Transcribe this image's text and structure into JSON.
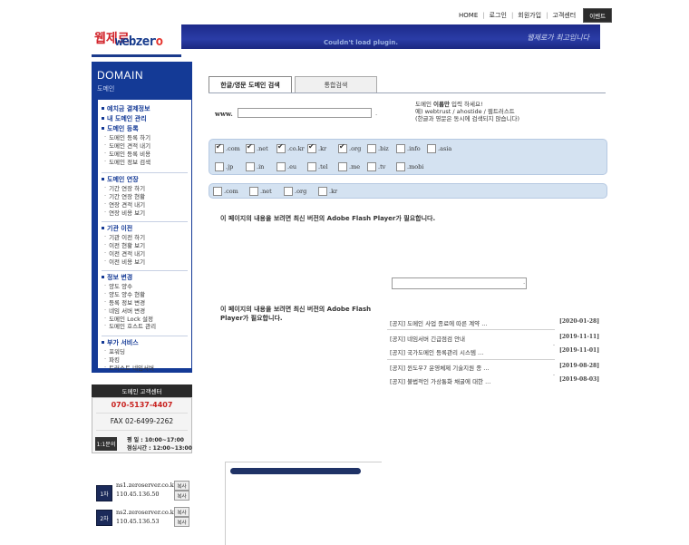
{
  "topnav": {
    "items": [
      "HOME",
      "로그인",
      "회원가입",
      "고객센터"
    ],
    "event_label": "이벤트"
  },
  "header": {
    "logo_kr": "웹제로",
    "logo_en_main": "webzer",
    "logo_en_last": "o",
    "plugin_message": "Couldn't load plugin.",
    "slogan": "웹제로가 최고입니다"
  },
  "sidebar": {
    "title": "DOMAIN",
    "subtitle": "도메인",
    "sections": [
      {
        "title": "예치금 결제정보",
        "items": []
      },
      {
        "title": "내 도메인 관리",
        "items": []
      },
      {
        "title": "도메인 등록",
        "items": [
          "도메인 등록 하기",
          "도메인 견적 내기",
          "도메인 등록 비용",
          "도메인 정보 검색"
        ]
      },
      {
        "title": "도메인 연장",
        "items": [
          "기간 연장 하기",
          "기간 연장 현황",
          "연장 견적 내기",
          "연장 비용 보기"
        ]
      },
      {
        "title": "기관 이전",
        "items": [
          "기관 이전 하기",
          "이전 현황 보기",
          "이전 견적 내기",
          "이전 비용 보기"
        ]
      },
      {
        "title": "정보 변경",
        "items": [
          "양도 양수",
          "양도 양수 현황",
          "등록 정보 변경",
          "네임 서버 변경",
          "도메인 Lock 설정",
          "도메인 호스트 관리"
        ]
      },
      {
        "title": "부가 서비스",
        "items": [
          "포워딩",
          "파킹",
          "트러스트 네임서버"
        ]
      }
    ]
  },
  "customer_center": {
    "title": "도메인 고객센터",
    "tel": "070-5137-4407",
    "fax": "FAX 02-6499-2262",
    "inquiry_label": "1:1문의",
    "hours_line1": "평    일 : 10:00~17:00",
    "hours_line2": "점심시간 : 12:00~13:00"
  },
  "nameservers": [
    {
      "no": "1차",
      "host": "ns1.zeroserver.co.kr",
      "ip": "110.45.136.50",
      "copy": "복사"
    },
    {
      "no": "2차",
      "host": "ns2.zeroserver.co.kr",
      "ip": "110.45.136.53",
      "copy": "복사"
    }
  ],
  "search": {
    "tabs": [
      "한글/영문 도메인 검색",
      "통합검색"
    ],
    "prefix": "www.",
    "dot": ".",
    "help_line1_pre": "도메인 ",
    "help_line1_bold": "이름만",
    "help_line1_post": " 입력 하세요!",
    "help_line2": "예) webtrust / ahostide / 웹트러스트",
    "help_line3": "(한글과 영문은 동시에 검색되지 않습니다)"
  },
  "tlds": {
    "row1": [
      {
        "label": ".com",
        "checked": true
      },
      {
        "label": ".net",
        "checked": true
      },
      {
        "label": ".co.kr",
        "checked": true
      },
      {
        "label": ".kr",
        "checked": true
      },
      {
        "label": ".org",
        "checked": true
      },
      {
        "label": ".biz",
        "checked": false
      },
      {
        "label": ".info",
        "checked": false
      },
      {
        "label": ".asia",
        "checked": false
      }
    ],
    "row2": [
      {
        "label": ".jp",
        "checked": false
      },
      {
        "label": ".in",
        "checked": false
      },
      {
        "label": ".eu",
        "checked": false
      },
      {
        "label": ".tel",
        "checked": false
      },
      {
        "label": ".me",
        "checked": false
      },
      {
        "label": ".tv",
        "checked": false
      },
      {
        "label": ".mobi",
        "checked": false
      }
    ],
    "row3": [
      {
        "label": ".com",
        "checked": false
      },
      {
        "label": ".net",
        "checked": false
      },
      {
        "label": ".org",
        "checked": false
      },
      {
        "label": ".kr",
        "checked": false
      }
    ]
  },
  "flash": {
    "msg1": "이 페이지의 내용을 보려면 최신 버전의 Adobe Flash Player가 필요합니다.",
    "msg2": "이 페이지의 내용을 보려면 최신 버전의 Adobe Flash Player가 필요합니다.",
    "mid_dot": "."
  },
  "notices": [
    {
      "title": "[공지] 도메인 사업 종료에 따른 계약 ...",
      "date": "[2020-01-28]"
    },
    {
      "title": "[공지] 네임서버 긴급점검 안내",
      "date": "[2019-11-11]"
    },
    {
      "title": "[공지] 국가도메인 등록관리 시스템 ...",
      "date": "[2019-11-01]"
    },
    {
      "title": "[공지] 윈도우7 운영체제 기술지원 종 ...",
      "date": "[2019-08-28]"
    },
    {
      "title": "[공지] 불법적인 가상통화 채굴에 대한 ...",
      "date": "[2019-08-03]"
    }
  ]
}
